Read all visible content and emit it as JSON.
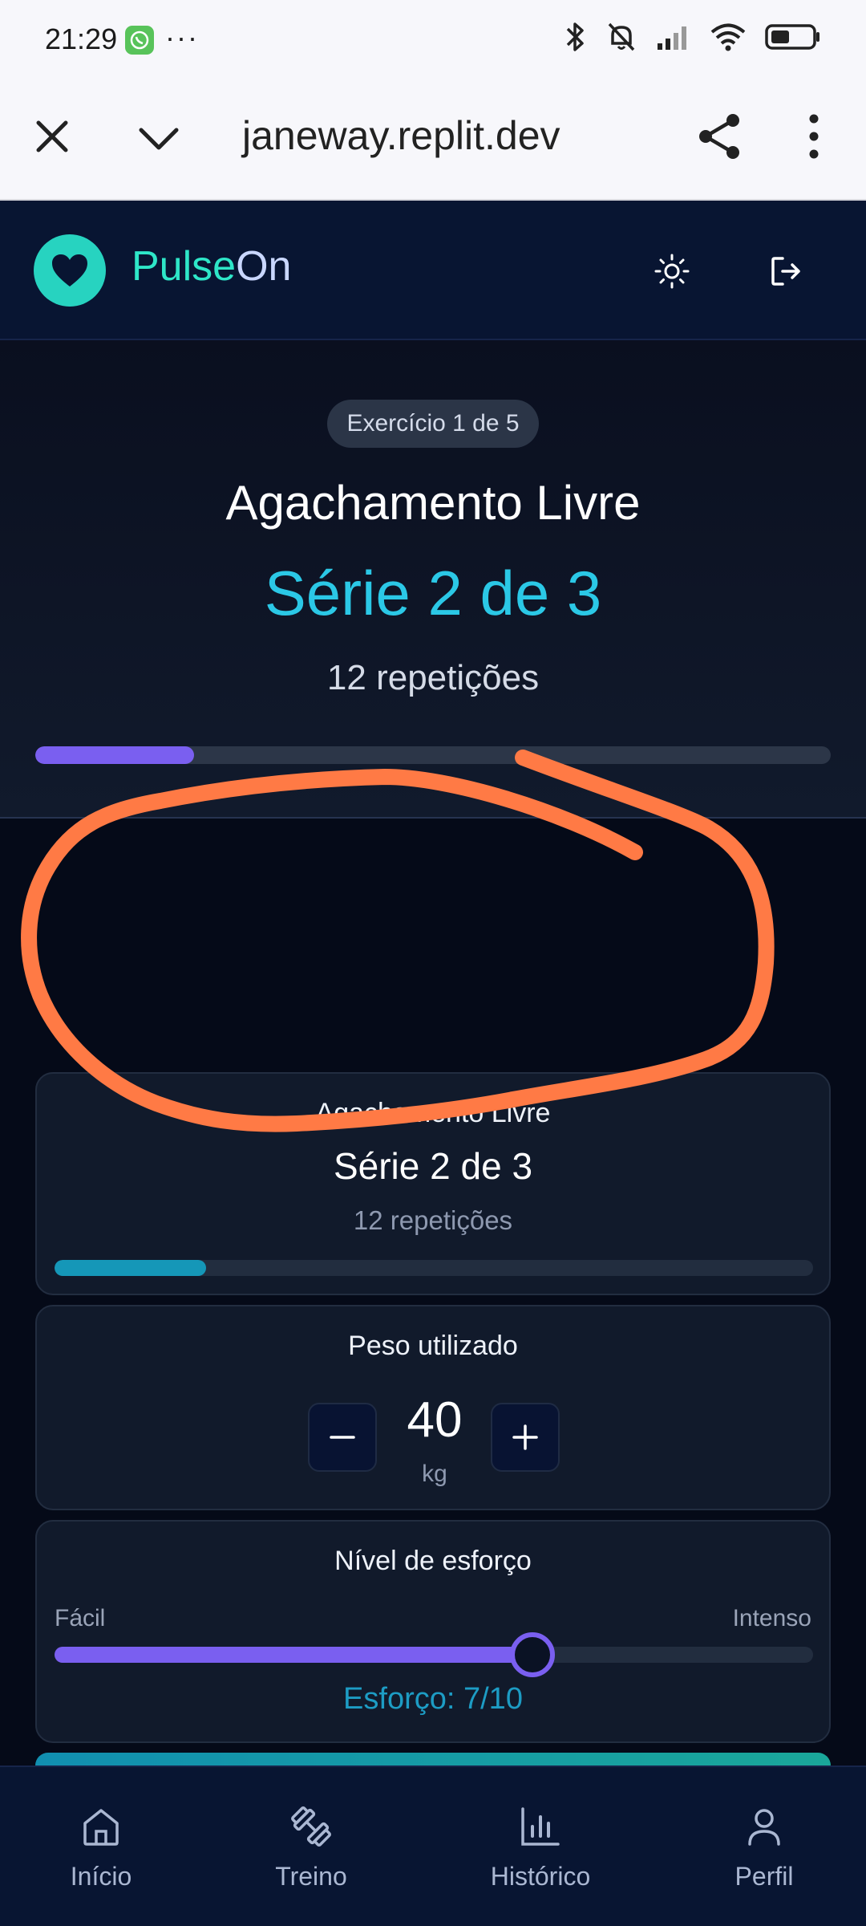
{
  "status_bar": {
    "time": "21:29",
    "more_dots": "···",
    "icons": [
      "whatsapp-icon",
      "bluetooth-icon",
      "mute-icon",
      "signal-icon",
      "wifi-icon",
      "battery-icon"
    ]
  },
  "browser": {
    "url": "janeway.replit.dev",
    "icons": [
      "close-icon",
      "chevron-down-icon",
      "share-icon",
      "more-vert-icon"
    ]
  },
  "app_header": {
    "brand_part1": "Pulse",
    "brand_part2": "On",
    "icons": [
      "heart-icon",
      "sun-icon",
      "logout-icon"
    ]
  },
  "hero": {
    "exercise_counter": "Exercício 1 de 5",
    "exercise_name": "Agachamento Livre",
    "set_label": "Série 2 de 3",
    "reps_label": "12 repetições",
    "progress": 0.2
  },
  "set_card": {
    "exercise_name": "Agachamento Livre",
    "set_label": "Série 2 de 3",
    "reps_label": "12 repetições",
    "progress": 0.2
  },
  "weight_card": {
    "title": "Peso utilizado",
    "value": "40",
    "unit": "kg",
    "decrement_icon": "minus-icon",
    "increment_icon": "plus-icon"
  },
  "effort_card": {
    "title": "Nível de esforço",
    "min_label": "Fácil",
    "max_label": "Intenso",
    "value": 7,
    "max": 10,
    "value_label": "Esforço: 7/10"
  },
  "bottom_nav": [
    {
      "label": "Início",
      "icon": "home-icon"
    },
    {
      "label": "Treino",
      "icon": "dumbbell-icon"
    },
    {
      "label": "Histórico",
      "icon": "bar-chart-icon"
    },
    {
      "label": "Perfil",
      "icon": "user-icon"
    }
  ],
  "colors": {
    "accent_teal": "#2ee6c8",
    "accent_cyan": "#2bc8e6",
    "accent_purple": "#7a5ff0",
    "annotation_orange": "#ff7a45"
  }
}
